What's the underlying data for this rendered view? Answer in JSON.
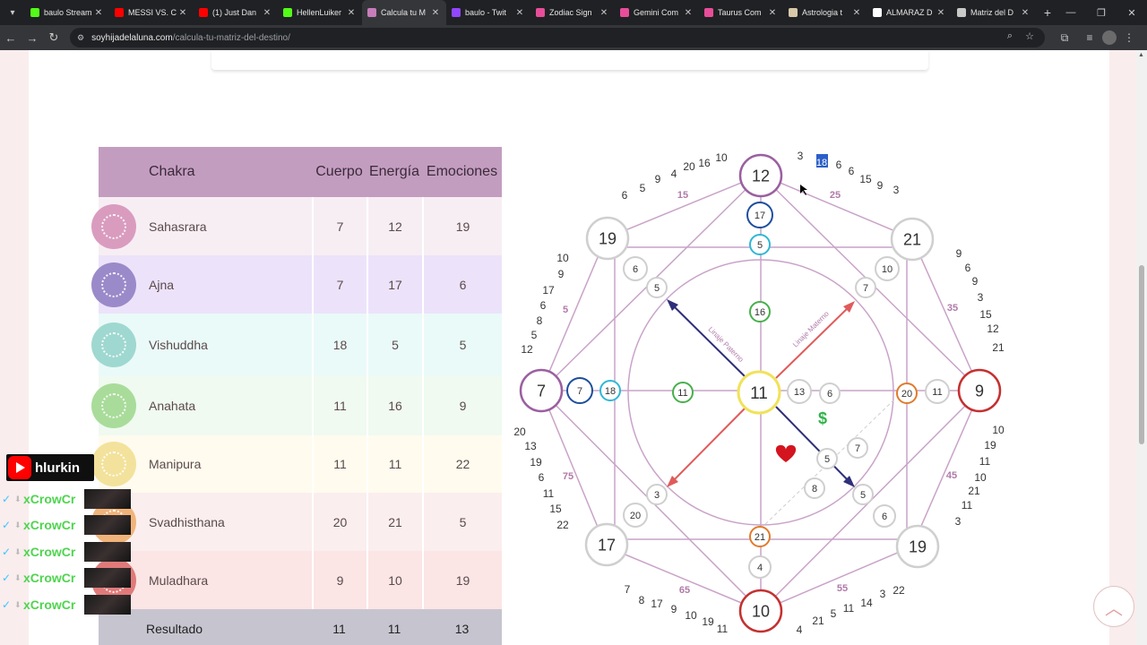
{
  "browser": {
    "tabs": [
      {
        "label": "baulo Stream",
        "color": "#53fc18"
      },
      {
        "label": "MESSI VS. C",
        "color": "#ff0000"
      },
      {
        "label": "(1) Just Dan",
        "color": "#ff0000"
      },
      {
        "label": "HellenLuiker",
        "color": "#53fc18"
      },
      {
        "label": "Calcula tu M",
        "color": "#c77dba"
      },
      {
        "label": "baulo - Twit",
        "color": "#9146ff"
      },
      {
        "label": "Zodiac Sign",
        "color": "#e84d9a"
      },
      {
        "label": "Gemini Com",
        "color": "#e84d9a"
      },
      {
        "label": "Taurus Com",
        "color": "#e84d9a"
      },
      {
        "label": "Astrologia t",
        "color": "#d8c8a8"
      },
      {
        "label": "ALMARAZ D",
        "color": "#ffffff"
      },
      {
        "label": "Matriz del D",
        "color": "#c8c8c8"
      }
    ],
    "active_tab": 4,
    "url_domain": "soyhijadelaluna.com",
    "url_path": "/calcula-tu-matriz-del-destino/"
  },
  "table": {
    "headers": {
      "chakra": "Chakra",
      "body": "Cuerpo",
      "energy": "Energía",
      "emotions": "Emociones"
    },
    "rows": [
      {
        "name": "Sahasrara",
        "body": "7",
        "energy": "12",
        "emotions": "19",
        "bg": "#f7eef4",
        "icon": "#d99cbf"
      },
      {
        "name": "Ajna",
        "body": "7",
        "energy": "17",
        "emotions": "6",
        "bg": "#ece3fa",
        "icon": "#9b8ac9"
      },
      {
        "name": "Vishuddha",
        "body": "18",
        "energy": "5",
        "emotions": "5",
        "bg": "#eafaf8",
        "icon": "#9fd8d0"
      },
      {
        "name": "Anahata",
        "body": "11",
        "energy": "16",
        "emotions": "9",
        "bg": "#f0faf0",
        "icon": "#a9dc9a"
      },
      {
        "name": "Manipura",
        "body": "11",
        "energy": "11",
        "emotions": "22",
        "bg": "#fffbef",
        "icon": "#f3e29c"
      },
      {
        "name": "Svadhisthana",
        "body": "20",
        "energy": "21",
        "emotions": "5",
        "bg": "#fbeeee",
        "icon": "#f0b47a"
      },
      {
        "name": "Muladhara",
        "body": "9",
        "energy": "10",
        "emotions": "19",
        "bg": "#fbe5e5",
        "icon": "#e07a7a"
      }
    ],
    "result": {
      "label": "Resultado",
      "body": "11",
      "energy": "11",
      "emotions": "13"
    }
  },
  "diagram": {
    "big_circles": [
      {
        "value": "12"
      },
      {
        "value": "21"
      },
      {
        "value": "9"
      },
      {
        "value": "19"
      },
      {
        "value": "10"
      },
      {
        "value": "17"
      },
      {
        "value": "7"
      },
      {
        "value": "19"
      }
    ],
    "center": "11",
    "small_circles": [
      "17",
      "5",
      "16",
      "7",
      "18",
      "11",
      "13",
      "6",
      "20",
      "11",
      "6",
      "10",
      "5",
      "7",
      "3",
      "20",
      "21",
      "4",
      "5",
      "8",
      "7",
      "5",
      "6"
    ],
    "lineage_paternal": "Linaje Paterno",
    "lineage_maternal": "Linaje Materno",
    "money_symbol": "$",
    "heart_color": "#d4141f",
    "highlighted_tick": "18",
    "ages_labels": [
      "25",
      "35",
      "45",
      "55",
      "65",
      "75",
      "5",
      "15"
    ],
    "outer_numbers_top": [
      "6",
      "5",
      "9",
      "4",
      "20",
      "16",
      "10",
      "3",
      "18",
      "6",
      "6",
      "15",
      "9",
      "3"
    ],
    "outer_numbers_right": [
      "9",
      "6",
      "9",
      "3",
      "15",
      "12",
      "21",
      "10",
      "19",
      "11",
      "10",
      "21",
      "11",
      "3"
    ],
    "outer_numbers_bottom": [
      "22",
      "3",
      "14",
      "11",
      "5",
      "21",
      "4",
      "11",
      "19",
      "10",
      "9",
      "17",
      "8",
      "7"
    ],
    "outer_numbers_left": [
      "10",
      "9",
      "17",
      "6",
      "8",
      "5",
      "12",
      "22",
      "20",
      "13",
      "19",
      "6",
      "11",
      "15",
      "22"
    ]
  },
  "overlay": {
    "channel": "hlurkin",
    "chat_name": "xCrowCr"
  }
}
